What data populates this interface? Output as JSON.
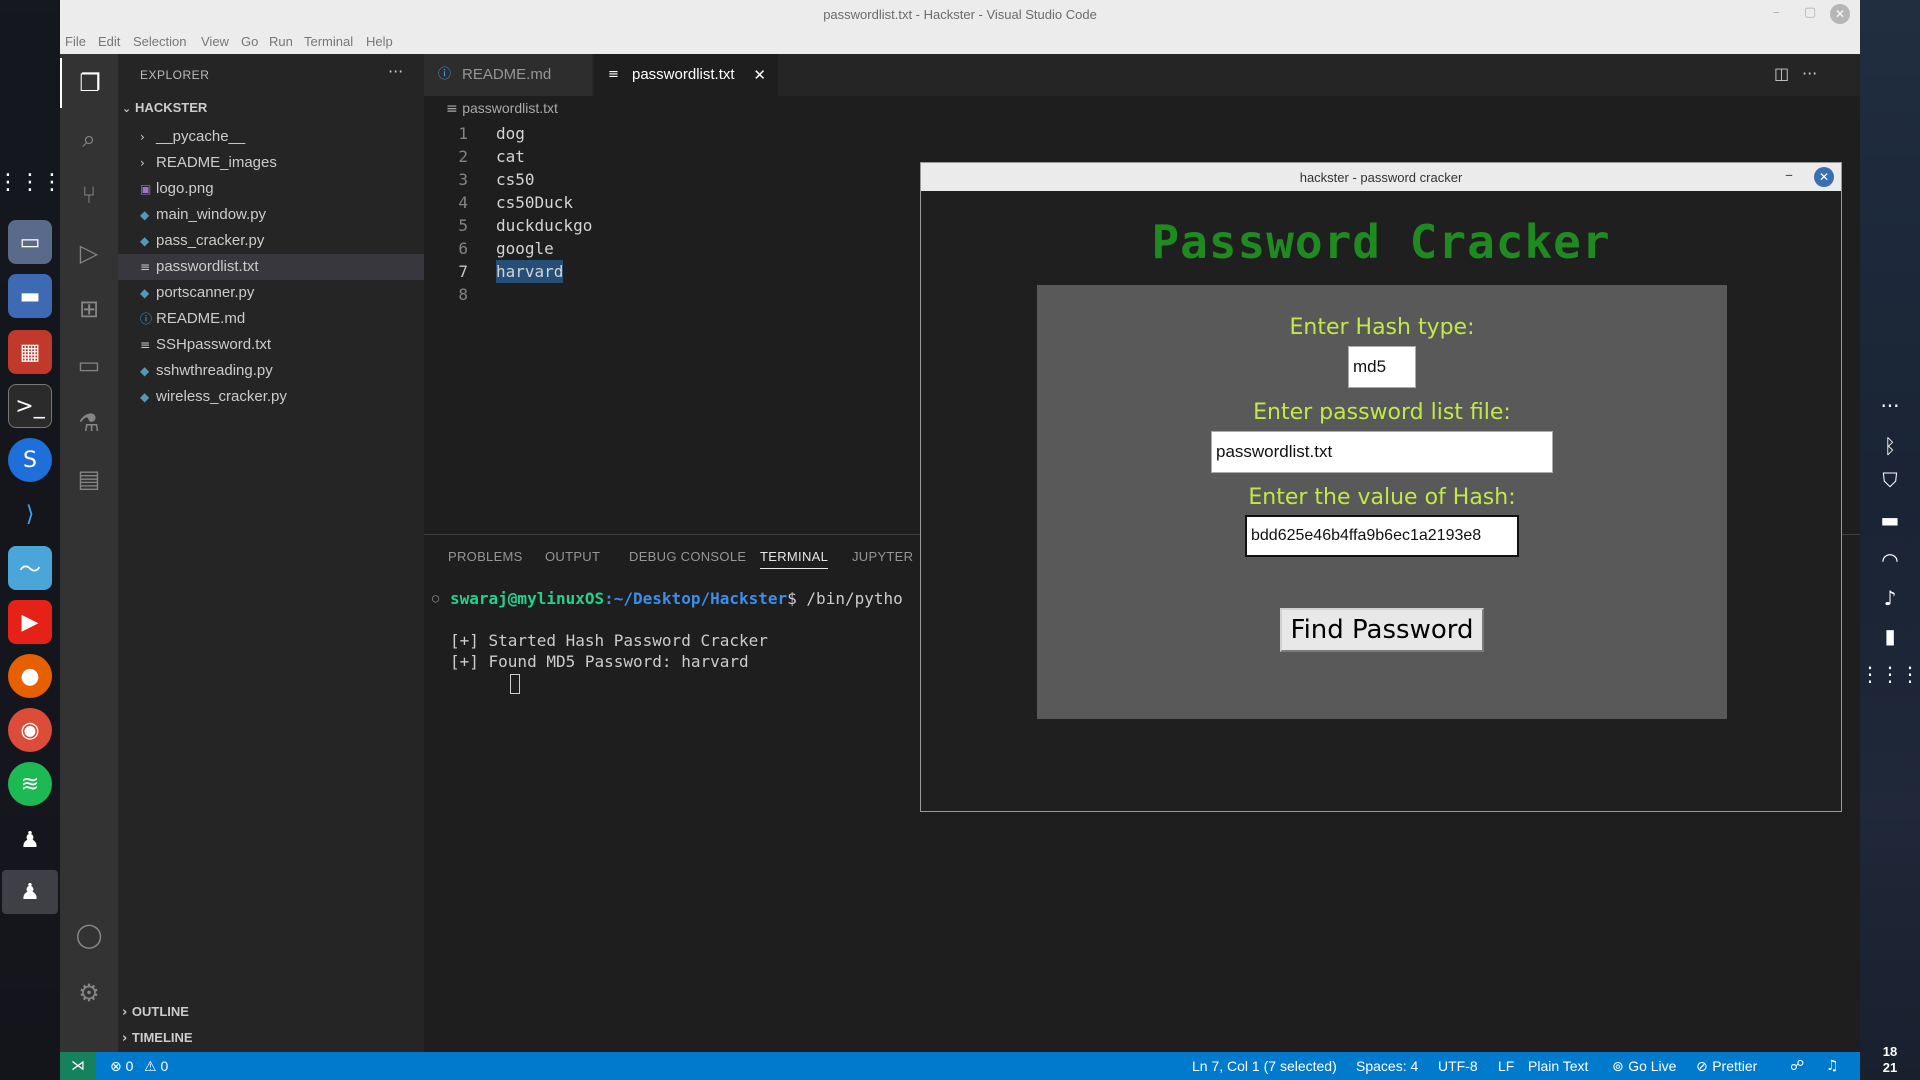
{
  "vscode": {
    "window_title": "passwordlist.txt - Hackster - Visual Studio Code",
    "menu": [
      "File",
      "Edit",
      "Selection",
      "View",
      "Go",
      "Run",
      "Terminal",
      "Help"
    ],
    "explorer": {
      "header": "EXPLORER",
      "more": "···",
      "folder": "HACKSTER",
      "items": [
        {
          "label": "__pycache__",
          "type": "folder"
        },
        {
          "label": "README_images",
          "type": "folder"
        },
        {
          "label": "logo.png",
          "type": "image"
        },
        {
          "label": "main_window.py",
          "type": "python"
        },
        {
          "label": "pass_cracker.py",
          "type": "python"
        },
        {
          "label": "passwordlist.txt",
          "type": "text",
          "selected": true
        },
        {
          "label": "portscanner.py",
          "type": "python"
        },
        {
          "label": "README.md",
          "type": "info"
        },
        {
          "label": "SSHpassword.txt",
          "type": "text"
        },
        {
          "label": "sshwthreading.py",
          "type": "python"
        },
        {
          "label": "wireless_cracker.py",
          "type": "python"
        }
      ],
      "outline": "OUTLINE",
      "timeline": "TIMELINE"
    },
    "tabs": [
      {
        "label": "README.md",
        "icon": "info-icon",
        "active": false
      },
      {
        "label": "passwordlist.txt",
        "icon": "text-file-icon",
        "active": true,
        "close": "✕"
      }
    ],
    "breadcrumb": "passwordlist.txt",
    "editor_lines": [
      {
        "num": "1",
        "text": "dog"
      },
      {
        "num": "2",
        "text": "cat"
      },
      {
        "num": "3",
        "text": "cs50"
      },
      {
        "num": "4",
        "text": "cs50Duck"
      },
      {
        "num": "5",
        "text": "duckduckgo"
      },
      {
        "num": "6",
        "text": "google"
      },
      {
        "num": "7",
        "text": "harvard"
      },
      {
        "num": "8",
        "text": ""
      }
    ],
    "panel_tabs": [
      "PROBLEMS",
      "OUTPUT",
      "DEBUG CONSOLE",
      "TERMINAL",
      "JUPYTER"
    ],
    "terminal": {
      "prompt_user": "swaraj@mylinuxOS",
      "prompt_path": ":~/Desktop/Hackster",
      "prompt_cmd": "$ /bin/pytho",
      "line1": "[+] Started Hash Password Cracker",
      "line2": "[+] Found MD5 Password: harvard"
    },
    "status": {
      "errors": "⊗ 0",
      "warnings": "⚠ 0",
      "position": "Ln 7, Col 1 (7 selected)",
      "spaces": "Spaces: 4",
      "encoding": "UTF-8",
      "eol": "LF",
      "language": "Plain Text",
      "golive": "Go Live",
      "prettier": "Prettier"
    }
  },
  "dialog": {
    "title": "hackster - password cracker",
    "heading": "Password Cracker",
    "hash_type_label": "Enter Hash type:",
    "hash_type_value": "md5",
    "list_label": "Enter password list file:",
    "list_value": "passwordlist.txt",
    "hash_label": "Enter the value of Hash:",
    "hash_value": "bdd625e46b4ffa9b6ec1a2193e8",
    "button": "Find Password",
    "heading_color": "#1f8a1f",
    "label_color": "#c3e84a"
  },
  "clock": {
    "hour": "18",
    "minute": "21"
  }
}
